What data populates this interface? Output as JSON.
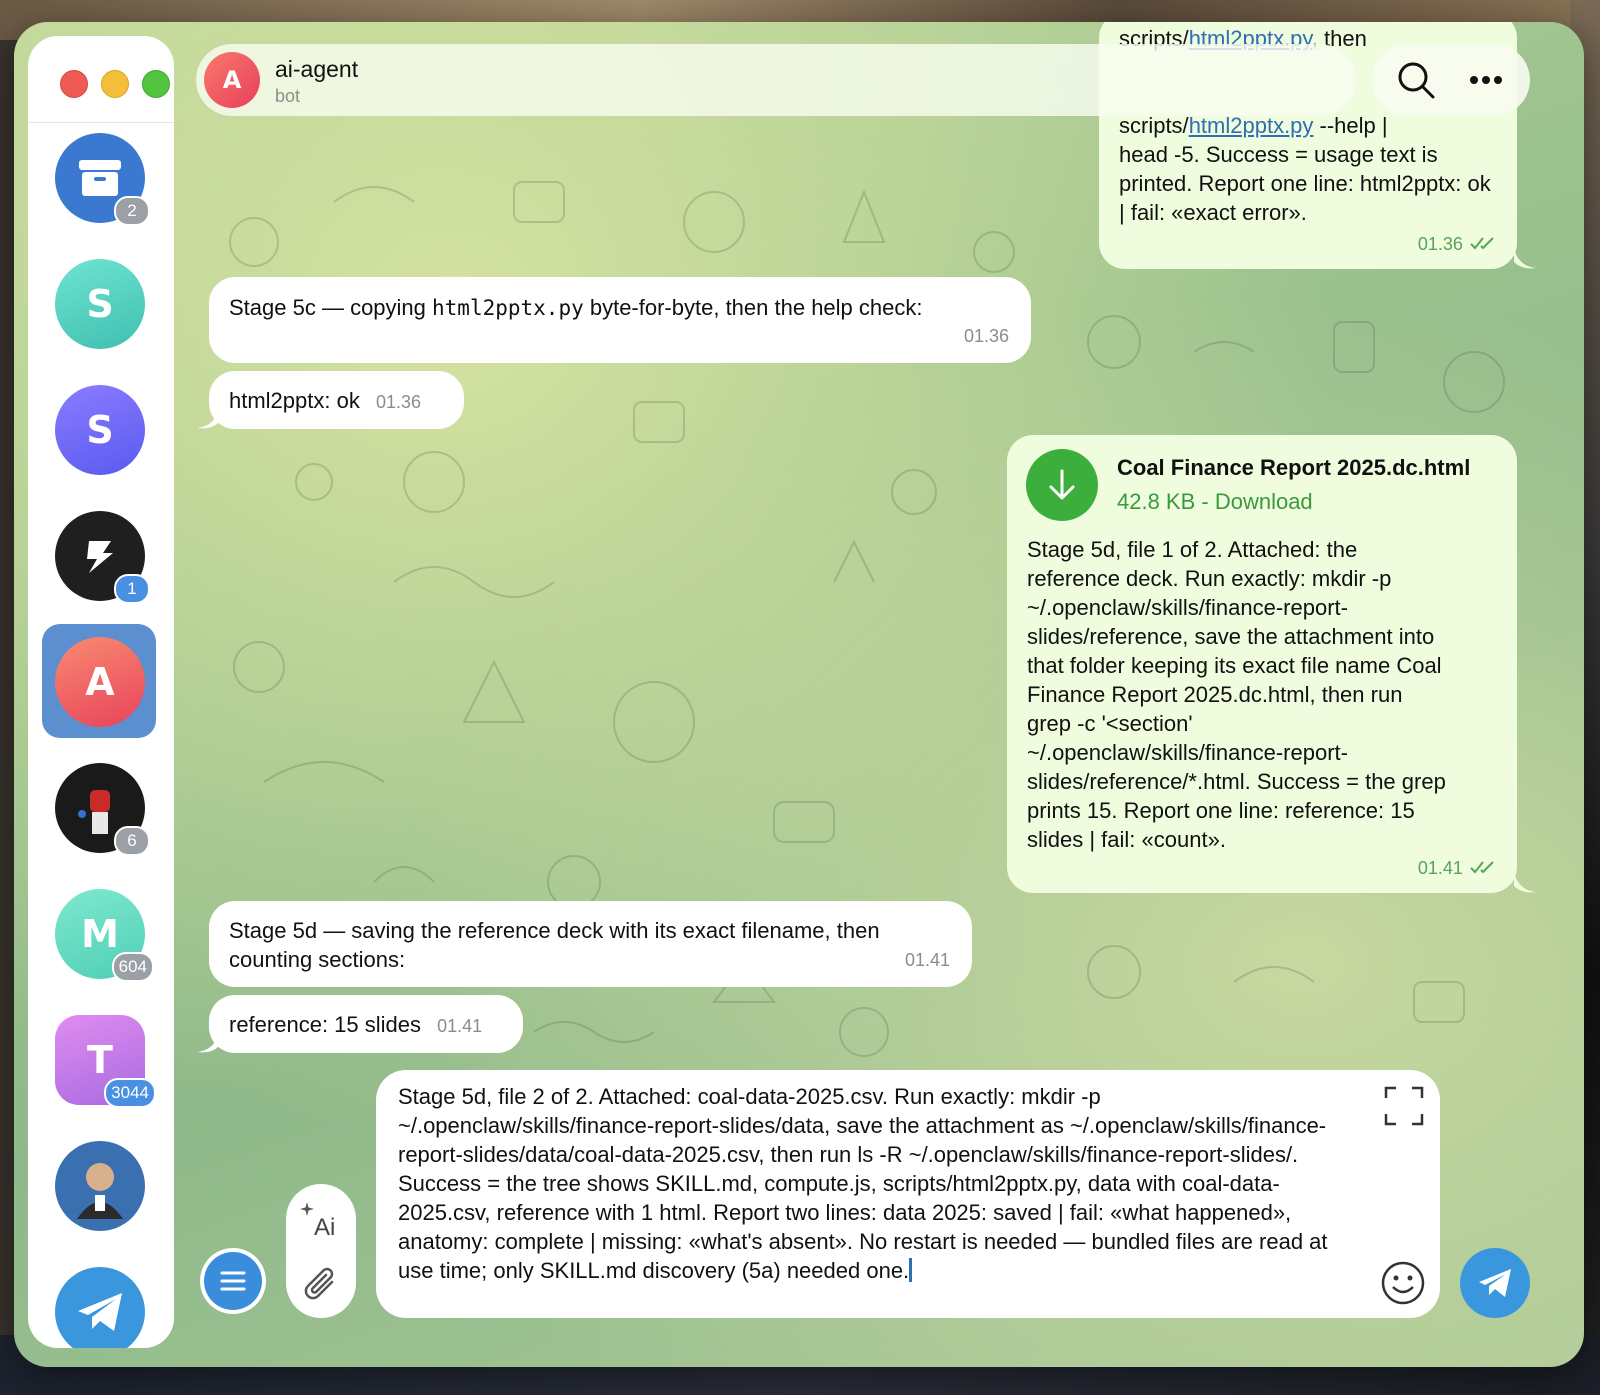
{
  "header": {
    "avatar_letter": "A",
    "title": "ai-agent",
    "subtitle": "bot",
    "actions": [
      "search-icon",
      "more-icon"
    ]
  },
  "sidebar": {
    "chats": [
      {
        "type": "archive",
        "icon": "archive-icon",
        "badge": "2",
        "color": "#3b78d0"
      },
      {
        "letter": "S",
        "color": "#4fd1c5"
      },
      {
        "letter": "S",
        "color": "#6e6bf5"
      },
      {
        "type": "logo",
        "badge": "1",
        "color": "#1f1f1f"
      },
      {
        "letter": "A",
        "color": "#ef5a5a",
        "active": true
      },
      {
        "type": "photo",
        "badge": "6",
        "color": "#1a1a1a"
      },
      {
        "letter": "M",
        "badge": "604",
        "color": "#5fdcc0"
      },
      {
        "letter": "T",
        "badge": "3044",
        "color": "#c27be8"
      },
      {
        "type": "photo",
        "color": "#3a6fb0"
      },
      {
        "type": "telegram",
        "icon": "telegram-icon",
        "color": "#3a97dd"
      }
    ]
  },
  "messages": {
    "m1": {
      "direction": "out",
      "partial_line_a": "scripts/",
      "partial_link_a": "html2pptx.py",
      "partial_text_a": ", then",
      "line_prefix": "scripts/",
      "link": "html2pptx.py",
      "line_suffix": " --help |",
      "rest": "head -5. Success = usage text is printed. Report one line: html2pptx: ok | fail: «exact error».",
      "time": "01.36"
    },
    "m2": {
      "direction": "in",
      "text_before": "Stage 5c — copying ",
      "code": "html2pptx.py",
      "text_after": " byte-for-byte, then the help check:",
      "time": "01.36"
    },
    "m3": {
      "direction": "in",
      "text": "html2pptx: ok",
      "time": "01.36"
    },
    "m4": {
      "direction": "out",
      "file_name": "Coal Finance Report 2025.dc.html",
      "file_size": "42.8 KB - Download",
      "text": "Stage 5d, file 1 of 2. Attached: the reference deck. Run exactly: mkdir -p ~/.openclaw/skills/finance-report-slides/reference, save the attachment into that folder keeping its exact file name Coal Finance Report 2025.dc.html, then run grep -c '<section' ~/.openclaw/skills/finance-report-slides/reference/*.html. Success = the grep prints 15. Report one line: reference: 15 slides | fail: «count».",
      "time": "01.41"
    },
    "m5": {
      "direction": "in",
      "text": "Stage 5d — saving the reference deck with its exact filename, then counting sections:",
      "time": "01.41"
    },
    "m6": {
      "direction": "in",
      "text": "reference: 15 slides",
      "time": "01.41"
    }
  },
  "composer": {
    "text": "Stage 5d, file 2 of 2. Attached: coal-data-2025.csv. Run exactly: mkdir -p ~/.openclaw/skills/finance-report-slides/data, save the attachment as ~/.openclaw/skills/finance-report-slides/data/coal-data-2025.csv, then run ls -R ~/.openclaw/skills/finance-report-slides/. Success = the tree shows SKILL.md, compute.js, scripts/html2pptx.py, data with coal-data-2025.csv, reference with 1 html. Report two lines: data 2025: saved | fail: «what happened», anatomy: complete | missing: «what's absent». No restart is needed — bundled files are read at use time; only SKILL.md discovery (5a) needed one.",
    "ai_label": "Ai"
  },
  "colors": {
    "outgoing_bubble": "#effcde",
    "incoming_bubble": "#ffffff",
    "accent_blue": "#3a97dd",
    "download_green": "#3cae3c"
  }
}
